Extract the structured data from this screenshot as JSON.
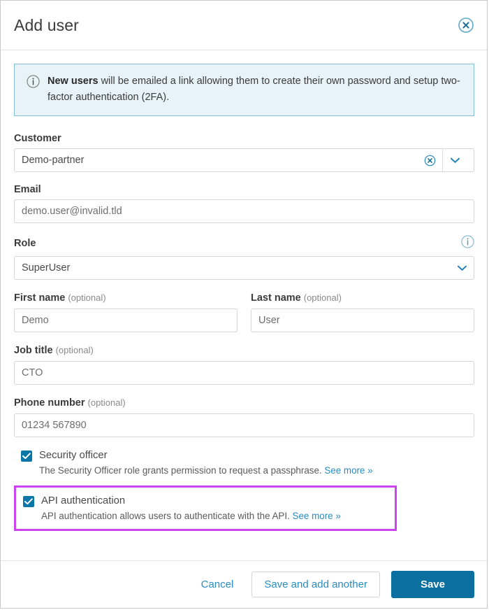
{
  "dialog": {
    "title": "Add user",
    "close_icon": "close-circle-icon"
  },
  "banner": {
    "icon": "info-circle-icon",
    "bold_lead": "New users",
    "text": " will be emailed a link allowing them to create their own password and setup two-factor authentication (2FA)."
  },
  "fields": {
    "customer": {
      "label": "Customer",
      "value": "Demo-partner",
      "clear_icon": "clear-circle-icon",
      "chevron_icon": "chevron-down-icon"
    },
    "email": {
      "label": "Email",
      "placeholder": "demo.user@invalid.tld",
      "value": "demo.user@invalid.tld"
    },
    "role": {
      "label": "Role",
      "value": "SuperUser",
      "info_icon": "info-circle-icon",
      "chevron_icon": "chevron-down-icon"
    },
    "first_name": {
      "label": "First name",
      "optional": "(optional)",
      "value": "Demo"
    },
    "last_name": {
      "label": "Last name",
      "optional": "(optional)",
      "value": "User"
    },
    "job_title": {
      "label": "Job title",
      "optional": "(optional)",
      "value": "CTO"
    },
    "phone_number": {
      "label": "Phone number",
      "optional": "(optional)",
      "value": "01234 567890"
    }
  },
  "checkboxes": {
    "security_officer": {
      "title": "Security officer",
      "checked": true,
      "description": "The Security Officer role grants permission to request a passphrase.",
      "link": "See more »"
    },
    "api_authentication": {
      "title": "API authentication",
      "checked": true,
      "description": "API authentication allows users to authenticate with the API.",
      "link": "See more »",
      "highlight_color": "#cc44ee"
    }
  },
  "footer": {
    "cancel_label": "Cancel",
    "save_add_another_label": "Save and add another",
    "save_label": "Save"
  },
  "colors": {
    "accent": "#0b6f9f",
    "link": "#2a8cc0",
    "banner_bg": "#e7f3f8",
    "banner_border": "#86c0d6",
    "highlight": "#cc44ee"
  }
}
